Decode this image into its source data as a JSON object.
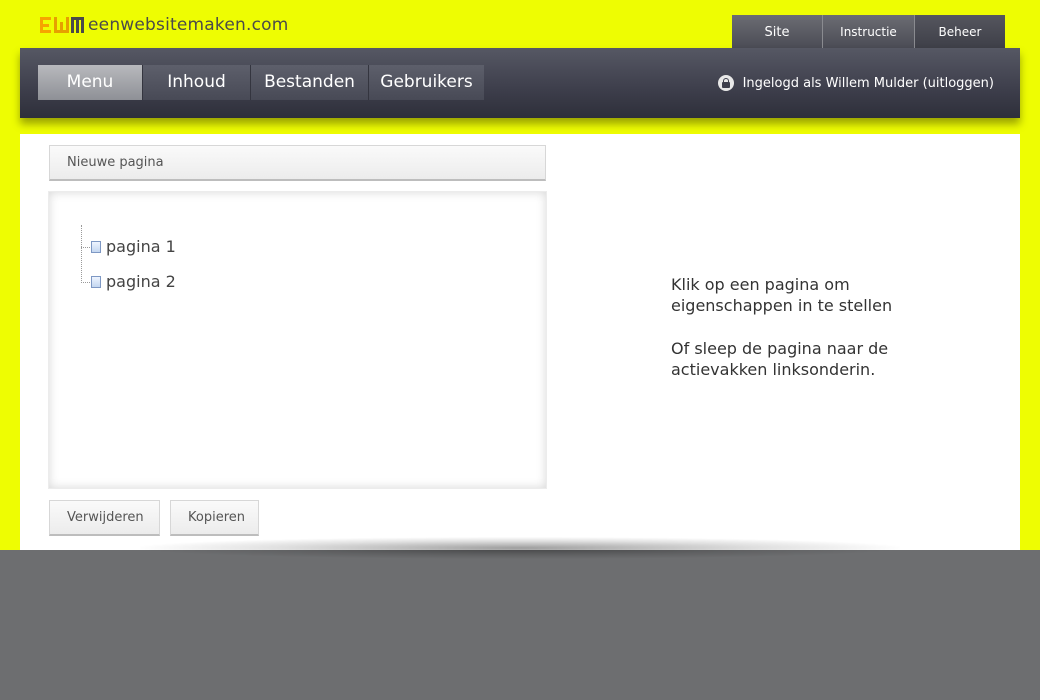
{
  "brand": {
    "logo_mark": "EWM",
    "site_name": "eenwebsitemaken.com",
    "colors": {
      "background": "#eefd02",
      "navbar": "#3d3e4b",
      "footer": "#6d6e70",
      "logo_mark": "#f6a400"
    }
  },
  "top_tabs": [
    {
      "label": "Site"
    },
    {
      "label": "Instructie"
    },
    {
      "label": "Beheer",
      "active": true
    }
  ],
  "nav": {
    "items": [
      {
        "label": "Menu",
        "active": true
      },
      {
        "label": "Inhoud"
      },
      {
        "label": "Bestanden"
      },
      {
        "label": "Gebruikers"
      }
    ],
    "login_text": "Ingelogd als Willem Mulder",
    "logout_text": "(uitloggen)",
    "lock_icon": "lock-icon"
  },
  "main": {
    "new_page_button": "Nieuwe pagina",
    "tree": [
      {
        "label": "pagina 1",
        "icon": "page-icon"
      },
      {
        "label": "pagina 2",
        "icon": "page-icon"
      }
    ],
    "delete_button": "Verwijderen",
    "copy_button": "Kopieren",
    "help_line1": "Klik op een pagina om eigenschappen in te stellen",
    "help_line2": "Of sleep de pagina naar de actievakken linksonderin."
  }
}
